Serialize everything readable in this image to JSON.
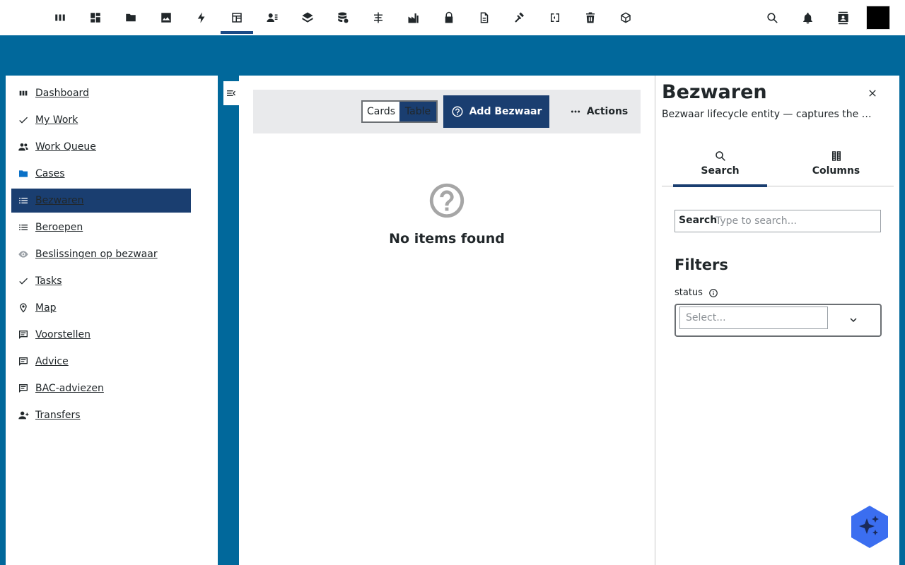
{
  "topbar": {
    "apps": [
      {
        "name": "app-dashboard-icon"
      },
      {
        "name": "app-grid-icon"
      },
      {
        "name": "app-folder-icon"
      },
      {
        "name": "app-image-icon"
      },
      {
        "name": "app-bolt-icon"
      },
      {
        "name": "app-table-icon",
        "active": true
      },
      {
        "name": "app-person-list-icon"
      },
      {
        "name": "app-layers-icon"
      },
      {
        "name": "app-database-icon"
      },
      {
        "name": "app-tools-icon"
      },
      {
        "name": "app-factory-icon"
      },
      {
        "name": "app-lock-icon"
      },
      {
        "name": "app-document-icon"
      },
      {
        "name": "app-gavel-icon"
      },
      {
        "name": "app-code-icon"
      },
      {
        "name": "app-trash-icon"
      },
      {
        "name": "app-cube-icon"
      }
    ],
    "right_icons": [
      "search-icon",
      "notifications-icon",
      "contacts-icon"
    ]
  },
  "sidebar": {
    "items": [
      {
        "label": "Dashboard",
        "icon": "dashboard-icon"
      },
      {
        "label": "My Work",
        "icon": "check-icon"
      },
      {
        "label": "Work Queue",
        "icon": "people-icon"
      },
      {
        "label": "Cases",
        "icon": "folder-icon"
      },
      {
        "label": "Bezwaren",
        "icon": "list-icon",
        "active": true
      },
      {
        "label": "Beroepen",
        "icon": "list-icon"
      },
      {
        "label": "Beslissingen op bezwaar",
        "icon": "eye-icon"
      },
      {
        "label": "Tasks",
        "icon": "check-icon"
      },
      {
        "label": "Map",
        "icon": "map-pin-icon"
      },
      {
        "label": "Voorstellen",
        "icon": "comment-icon"
      },
      {
        "label": "Advice",
        "icon": "comment-icon"
      },
      {
        "label": "BAC-adviezen",
        "icon": "comment-icon"
      },
      {
        "label": "Transfers",
        "icon": "person-add-icon"
      }
    ]
  },
  "toolbar": {
    "view_cards": "Cards",
    "view_table": "Table",
    "add_label": "Add Bezwaar",
    "actions_label": "Actions"
  },
  "empty": {
    "text": "No items found"
  },
  "panel": {
    "title": "Bezwaren",
    "subtitle": "Bezwaar lifecycle entity — captures the A...",
    "tabs": [
      {
        "label": "Search",
        "active": true
      },
      {
        "label": "Columns"
      }
    ],
    "search_label": "Search",
    "search_placeholder": "Type to search...",
    "filters_title": "Filters",
    "filter_status_label": "status",
    "select_placeholder": "Select..."
  },
  "colors": {
    "band": "#01689b",
    "primary": "#1a3e70",
    "toolbar_bg": "#e9eaec",
    "ai_fab": "#3b6ef0"
  }
}
